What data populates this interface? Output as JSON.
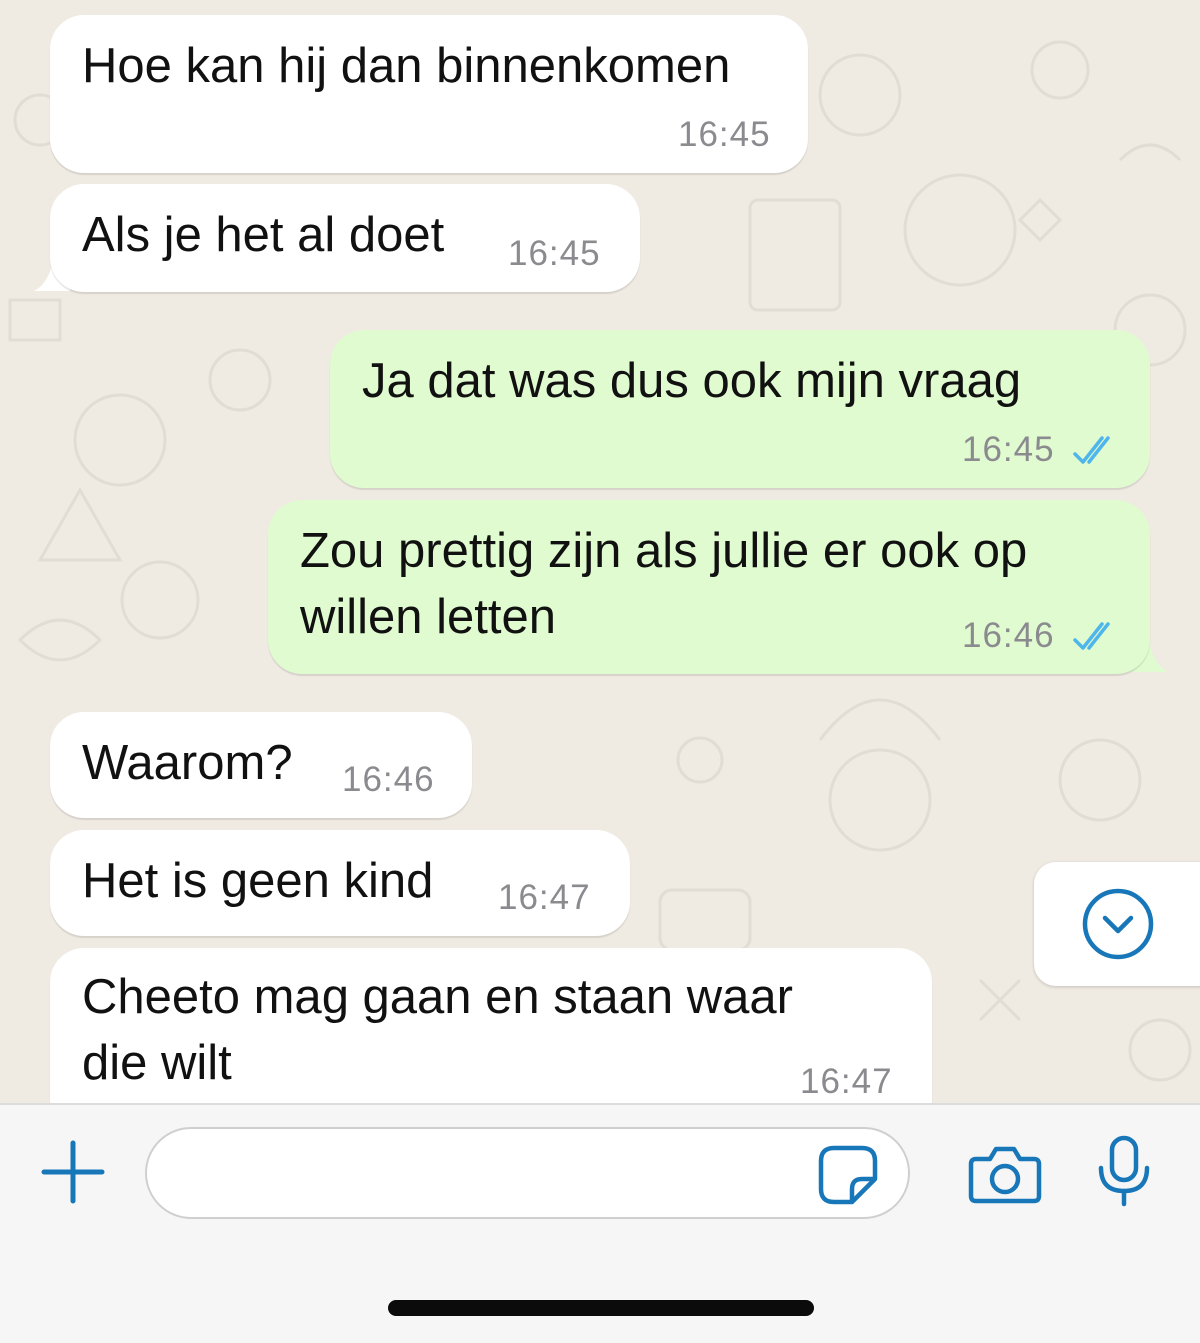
{
  "messages": [
    {
      "direction": "incoming",
      "lines": [
        "Hoe kan hij dan binnenkomen"
      ],
      "time": "16:45"
    },
    {
      "direction": "incoming",
      "lines": [
        "Als je het al doet"
      ],
      "time": "16:45"
    },
    {
      "direction": "outgoing",
      "lines": [
        "Ja dat was dus ook mijn vraag"
      ],
      "time": "16:45",
      "status": "read"
    },
    {
      "direction": "outgoing",
      "lines": [
        "Zou prettig zijn als jullie er ook op",
        "willen letten"
      ],
      "time": "16:46",
      "status": "read"
    },
    {
      "direction": "incoming",
      "lines": [
        "Waarom?"
      ],
      "time": "16:46"
    },
    {
      "direction": "incoming",
      "lines": [
        "Het is geen kind"
      ],
      "time": "16:47"
    },
    {
      "direction": "incoming",
      "lines": [
        "Cheeto mag gaan en staan waar",
        "die wilt"
      ],
      "time": "16:47"
    }
  ],
  "composer": {
    "input_value": "",
    "icons": [
      "plus-icon",
      "sticker-icon",
      "camera-icon",
      "microphone-icon"
    ]
  },
  "scroll_button": {
    "icon": "chevron-down-circle-icon"
  },
  "colors": {
    "accent": "#1877b8",
    "read_ticks": "#4fb6ec",
    "incoming_bubble": "#ffffff",
    "outgoing_bubble": "#e0fbd0",
    "chat_background": "#efeae2",
    "timestamp": "#8a8a8f"
  }
}
